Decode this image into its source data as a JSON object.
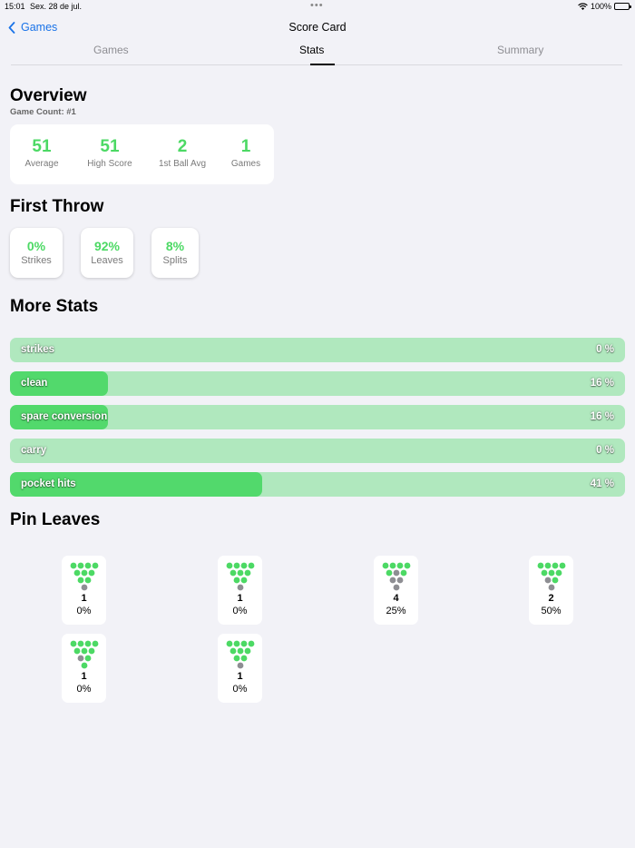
{
  "status": {
    "time": "15:01",
    "date": "Sex. 28 de jul.",
    "battery": "100%"
  },
  "nav": {
    "back_label": "Games",
    "title": "Score Card"
  },
  "tabs": [
    {
      "label": "Games",
      "active": false
    },
    {
      "label": "Stats",
      "active": true
    },
    {
      "label": "Summary",
      "active": false
    }
  ],
  "overview": {
    "heading": "Overview",
    "game_count": "Game Count:  #1",
    "items": [
      {
        "value": "51",
        "label": "Average"
      },
      {
        "value": "51",
        "label": "High Score"
      },
      {
        "value": "2",
        "label": "1st Ball Avg"
      },
      {
        "value": "1",
        "label": "Games"
      }
    ]
  },
  "first_throw": {
    "heading": "First Throw",
    "items": [
      {
        "value": "0%",
        "label": "Strikes"
      },
      {
        "value": "92%",
        "label": "Leaves"
      },
      {
        "value": "8%",
        "label": "Splits"
      }
    ]
  },
  "more_stats": {
    "heading": "More Stats",
    "bars": [
      {
        "label": "strikes",
        "pct": "0 %",
        "fraction": 0.0
      },
      {
        "label": "clean",
        "pct": "16 %",
        "fraction": 0.16
      },
      {
        "label": "spare conversion",
        "pct": "16 %",
        "fraction": 0.16
      },
      {
        "label": "carry",
        "pct": "0 %",
        "fraction": 0.0
      },
      {
        "label": "pocket hits",
        "pct": "41 %",
        "fraction": 0.41
      }
    ]
  },
  "pin_leaves": {
    "heading": "Pin Leaves",
    "items": [
      {
        "count": "1",
        "percent": "0%",
        "standing": [
          1
        ]
      },
      {
        "count": "1",
        "percent": "0%",
        "standing": [
          1
        ]
      },
      {
        "count": "4",
        "percent": "25%",
        "standing": [
          1,
          2,
          3,
          5
        ]
      },
      {
        "count": "2",
        "percent": "50%",
        "standing": [
          1,
          2
        ]
      },
      {
        "count": "1",
        "percent": "0%",
        "standing": [
          2
        ]
      },
      {
        "count": "1",
        "percent": "0%",
        "standing": [
          1
        ]
      }
    ]
  },
  "colors": {
    "accent_green": "#4cd964",
    "bar_fill": "#52d96c",
    "bar_bg": "#b0e8be",
    "pin_down": "#4cd964",
    "pin_standing": "#8e8e93",
    "link_blue": "#1a73e8"
  }
}
